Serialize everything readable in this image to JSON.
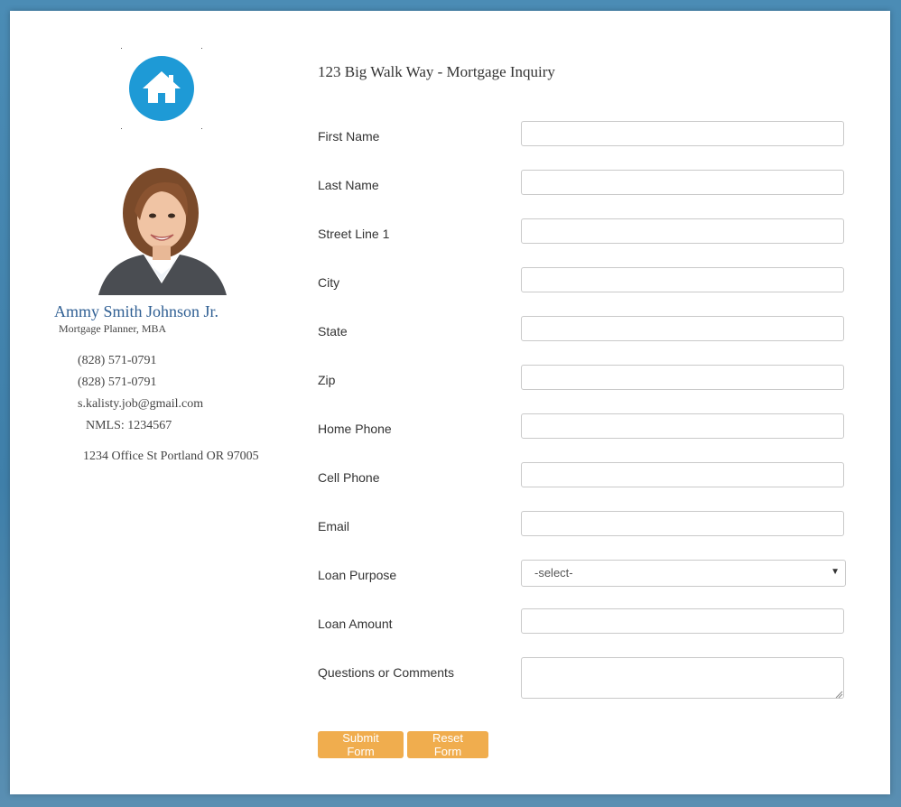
{
  "sidebar": {
    "logo_icon": "house-icon",
    "brand_color": "#1e9ad6",
    "agent_name": "Ammy Smith Johnson Jr.",
    "agent_title": "Mortgage Planner, MBA",
    "phone_1": "(828) 571-0791",
    "phone_2": "(828) 571-0791",
    "email": "s.kalisty.job@gmail.com",
    "nmls": "NMLS: 1234567",
    "address": "1234 Office St Portland OR 97005"
  },
  "form": {
    "title": "123 Big Walk Way - Mortgage Inquiry",
    "fields": {
      "first_name": {
        "label": "First Name",
        "value": ""
      },
      "last_name": {
        "label": "Last Name",
        "value": ""
      },
      "street": {
        "label": "Street Line 1",
        "value": ""
      },
      "city": {
        "label": "City",
        "value": ""
      },
      "state": {
        "label": "State",
        "value": ""
      },
      "zip": {
        "label": "Zip",
        "value": ""
      },
      "home_phone": {
        "label": "Home Phone",
        "value": ""
      },
      "cell_phone": {
        "label": "Cell Phone",
        "value": ""
      },
      "email": {
        "label": "Email",
        "value": ""
      },
      "loan_purpose": {
        "label": "Loan Purpose",
        "selected": "-select-"
      },
      "loan_amount": {
        "label": "Loan Amount",
        "value": ""
      },
      "comments": {
        "label": "Questions or Comments",
        "value": ""
      }
    },
    "buttons": {
      "submit": "Submit Form",
      "reset": "Reset Form",
      "color": "#f0ad4e"
    }
  }
}
